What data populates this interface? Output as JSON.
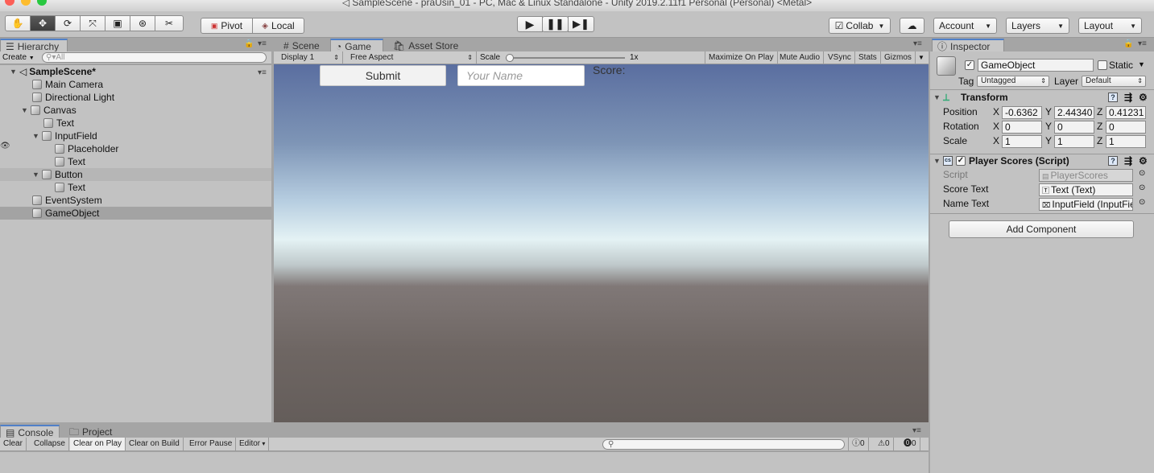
{
  "window": {
    "title": "SampleScene - praUsin_01 - PC, Mac & Linux Standalone - Unity 2019.2.11f1 Personal (Personal) <Metal>"
  },
  "toolbar": {
    "pivot_label": "Pivot",
    "local_label": "Local",
    "collab_label": "Collab",
    "account_label": "Account",
    "layers_label": "Layers",
    "layout_label": "Layout"
  },
  "hierarchy": {
    "tab_label": "Hierarchy",
    "create_label": "Create",
    "search_placeholder": "All",
    "scene_name": "SampleScene*",
    "items": [
      {
        "label": "Main Camera",
        "depth": 1,
        "expand": false
      },
      {
        "label": "Directional Light",
        "depth": 1,
        "expand": false
      },
      {
        "label": "Canvas",
        "depth": 1,
        "expand": true
      },
      {
        "label": "Text",
        "depth": 2,
        "expand": false
      },
      {
        "label": "InputField",
        "depth": 2,
        "expand": true
      },
      {
        "label": "Placeholder",
        "depth": 3,
        "expand": false
      },
      {
        "label": "Text",
        "depth": 3,
        "expand": false
      },
      {
        "label": "Button",
        "depth": 2,
        "expand": true
      },
      {
        "label": "Text",
        "depth": 3,
        "expand": false
      },
      {
        "label": "EventSystem",
        "depth": 1,
        "expand": false
      },
      {
        "label": "GameObject",
        "depth": 1,
        "expand": false
      }
    ]
  },
  "center": {
    "tabs": [
      {
        "label": "Scene",
        "icon": "grid-icon"
      },
      {
        "label": "Game",
        "icon": "pacman-icon"
      },
      {
        "label": "Asset Store",
        "icon": "store-icon"
      }
    ],
    "display_label": "Display 1",
    "aspect_label": "Free Aspect",
    "scale_label": "Scale",
    "scale_value": "1x",
    "scale_fraction": 0.0,
    "toggles": [
      "Maximize On Play",
      "Mute Audio",
      "VSync",
      "Stats",
      "Gizmos"
    ]
  },
  "game_view": {
    "submit_label": "Submit",
    "name_placeholder": "Your Name",
    "score_label": "Score:"
  },
  "inspector": {
    "tab_label": "Inspector",
    "object_name": "GameObject",
    "static_label": "Static",
    "tag_label": "Tag",
    "tag_value": "Untagged",
    "layer_label": "Layer",
    "layer_value": "Default",
    "transform": {
      "title": "Transform",
      "rows": [
        {
          "label": "Position",
          "x": "-0.6362",
          "y": "2.44340",
          "z": "0.41231"
        },
        {
          "label": "Rotation",
          "x": "0",
          "y": "0",
          "z": "0"
        },
        {
          "label": "Scale",
          "x": "1",
          "y": "1",
          "z": "1"
        }
      ]
    },
    "script_component": {
      "title": "Player Scores (Script)",
      "rows": [
        {
          "label": "Script",
          "value": "PlayerScores"
        },
        {
          "label": "Score Text",
          "value": "Text (Text)"
        },
        {
          "label": "Name Text",
          "value": "InputField (InputFie"
        }
      ]
    },
    "add_component_label": "Add Component"
  },
  "console": {
    "tabs": [
      "Console",
      "Project"
    ],
    "buttons": [
      "Clear",
      "Collapse",
      "Clear on Play",
      "Clear on Build",
      "Error Pause",
      "Editor"
    ],
    "counts": {
      "logs": "0",
      "warnings": "0",
      "errors": "0"
    }
  }
}
